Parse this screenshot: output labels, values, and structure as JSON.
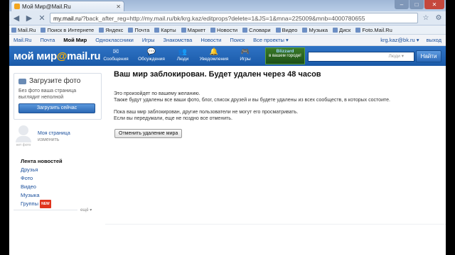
{
  "browser": {
    "tab_title": "Мой Мир@Mail.Ru",
    "url_host": "my.mail.ru",
    "url_rest": "/?back_after_reg=http://my.mail.ru/bk/krg.kaz/editprops?delete=1&JS=1&mna=225009&mnb=4000780655"
  },
  "bookmarks": [
    "Mail.Ru",
    "Поиск в Интернете",
    "Яндекс",
    "Почта",
    "Карты",
    "Маркет",
    "Новости",
    "Словари",
    "Видео",
    "Музыка",
    "Диск",
    "Foto.Mail.Ru"
  ],
  "mailnav": {
    "items": [
      "Mail.Ru",
      "Почта",
      "Мой Мир",
      "Одноклассники",
      "Игры",
      "Знакомства",
      "Новости",
      "Поиск",
      "Все проекты ▾"
    ],
    "account": "krg.kaz@bk.ru ▾",
    "logout": "выход"
  },
  "header": {
    "logo_a": "мой мир",
    "logo_at": "@",
    "logo_b": "mail.ru",
    "nav": [
      "Сообщения",
      "Обсуждения",
      "Люди",
      "Уведомления",
      "Игры"
    ],
    "ad_brand": "Blizzard",
    "ad_text": "в вашем городе!",
    "ad_go": "",
    "search_placeholder": "Люди ▾",
    "search_button": "Найти"
  },
  "sidebar": {
    "photo_title": "Загрузите фото",
    "photo_desc": "Без фото ваша страница выглядит неполной",
    "upload_button": "Загрузить сейчас",
    "avatar_caption": "нет фото",
    "mypage": "Моя страница",
    "edit": "изменить",
    "menu": [
      "Лента новостей",
      "Друзья",
      "Фото",
      "Видео",
      "Музыка",
      "Группы"
    ],
    "new_badge": "NEW",
    "more": "ещё ▾"
  },
  "main": {
    "title": "Ваш мир заблокирован. Будет удален через 48 часов",
    "p1": "Это произойдет по вашему желанию.",
    "p2": "Также будут удалены все ваши фото, блог, список друзей и вы будете удалены из всех сообществ, в которых состоите.",
    "p3": "Пока ваш мир заблокирован, другие пользователи не могут его просматривать.",
    "p4": "Если вы передумали, еще не поздно все отменить.",
    "cancel_button": "Отменить удаление мира"
  }
}
